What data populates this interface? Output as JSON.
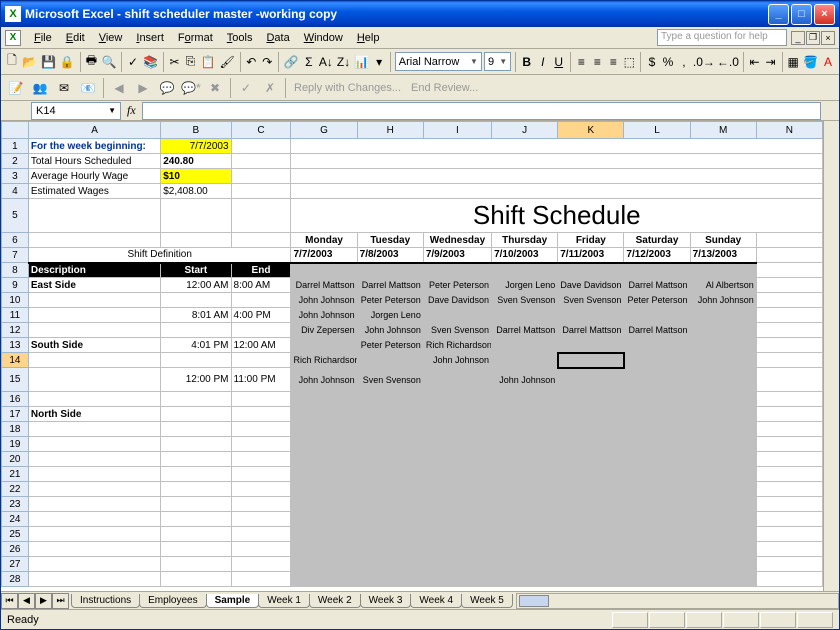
{
  "app": {
    "title": "Microsoft Excel - shift scheduler master -working copy"
  },
  "menu": {
    "file": "File",
    "edit": "Edit",
    "view": "View",
    "insert": "Insert",
    "format": "Format",
    "tools": "Tools",
    "data": "Data",
    "window": "Window",
    "help": "Help",
    "helpbox": "Type a question for help"
  },
  "toolbar": {
    "font": "Arial Narrow",
    "size": "9"
  },
  "toolbar2": {
    "reply": "Reply with Changes...",
    "end": "End Review..."
  },
  "namebox": "K14",
  "cols": [
    "A",
    "B",
    "C",
    "G",
    "H",
    "I",
    "J",
    "K",
    "L",
    "M",
    "N"
  ],
  "summary": {
    "weeklabel": "For the week beginning:",
    "weekval": "7/7/2003",
    "hourslabel": "Total Hours Scheduled",
    "hoursval": "240.80",
    "wagelabel": "Average Hourly Wage",
    "wageval": "$10",
    "estlabel": "Estimated Wages",
    "estval": "$2,408.00"
  },
  "title": "Shift Schedule",
  "days": {
    "mon": "Monday",
    "tue": "Tuesday",
    "wed": "Wednesday",
    "thu": "Thursday",
    "fri": "Friday",
    "sat": "Saturday",
    "sun": "Sunday"
  },
  "dates": {
    "mon": "7/7/2003",
    "tue": "7/8/2003",
    "wed": "7/9/2003",
    "thu": "7/10/2003",
    "fri": "7/11/2003",
    "sat": "7/12/2003",
    "sun": "7/13/2003"
  },
  "shiftdef": "Shift Definition",
  "hdr": {
    "desc": "Description",
    "start": "Start",
    "end": "End"
  },
  "rows": [
    {
      "n": 9,
      "desc": "East Side",
      "start": "12:00 AM",
      "end": "8:00 AM",
      "g": "Darrel Mattson",
      "h": "Darrel Mattson",
      "i": "Peter Peterson",
      "j": "Jorgen Leno",
      "k": "Dave Davidson",
      "l": "Darrel Mattson",
      "m": "Al Albertson"
    },
    {
      "n": 10,
      "desc": "",
      "start": "",
      "end": "",
      "g": "John Johnson",
      "h": "Peter Peterson",
      "i": "Dave Davidson",
      "j": "Sven Svenson",
      "k": "Sven Svenson",
      "l": "Peter Peterson",
      "m": "John Johnson"
    },
    {
      "n": 11,
      "desc": "",
      "start": "8:01 AM",
      "end": "4:00 PM",
      "g": "John Johnson",
      "h": "Jorgen Leno",
      "i": "",
      "j": "",
      "k": "",
      "l": "",
      "m": ""
    },
    {
      "n": 12,
      "desc": "",
      "start": "",
      "end": "",
      "g": "Div Zepersen",
      "h": "John Johnson",
      "i": "Sven Svenson",
      "j": "Darrel Mattson",
      "k": "Darrel Mattson",
      "l": "Darrel Mattson",
      "m": ""
    },
    {
      "n": 13,
      "desc": "South Side",
      "start": "4:01 PM",
      "end": "12:00 AM",
      "g": "",
      "h": "Peter Peterson",
      "i": "Rich Richardson",
      "j": "",
      "k": "",
      "l": "",
      "m": ""
    },
    {
      "n": 14,
      "desc": "",
      "start": "",
      "end": "",
      "g": "Rich Richardson",
      "h": "",
      "i": "John Johnson",
      "j": "",
      "k": "",
      "l": "",
      "m": "",
      "active": true
    },
    {
      "n": 15,
      "desc": "",
      "start": "12:00 PM",
      "end": "11:00 PM",
      "g": "John Johnson",
      "h": "Sven Svenson",
      "i": "",
      "j": "John Johnson",
      "k": "",
      "l": "",
      "m": ""
    },
    {
      "n": 16
    },
    {
      "n": 17,
      "desc": "North Side"
    },
    {
      "n": 18
    },
    {
      "n": 19
    },
    {
      "n": 20
    },
    {
      "n": 21
    },
    {
      "n": 22
    },
    {
      "n": 23
    },
    {
      "n": 24
    },
    {
      "n": 25
    },
    {
      "n": 26
    },
    {
      "n": 27
    },
    {
      "n": 28
    }
  ],
  "tabs": [
    "Instructions",
    "Employees",
    "Sample",
    "Week 1",
    "Week 2",
    "Week 3",
    "Week 4",
    "Week 5"
  ],
  "active_tab": "Sample",
  "status": "Ready"
}
